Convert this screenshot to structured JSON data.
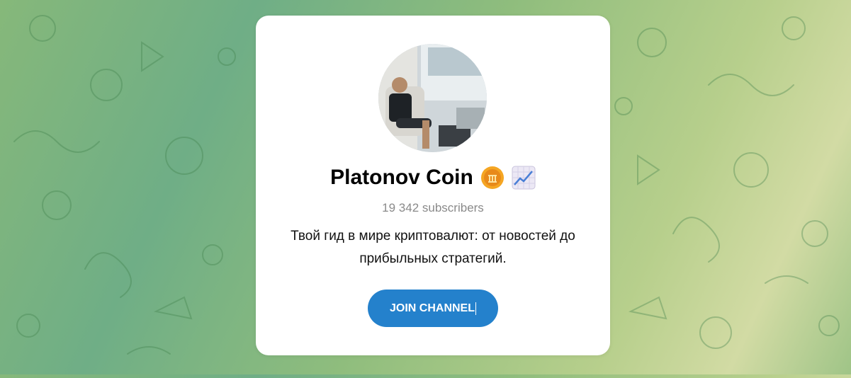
{
  "channel": {
    "title": "Platonov Coin",
    "subscribers": "19 342 subscribers",
    "description": "Твой гид в мире криптовалют: от новостей до прибыльных стратегий.",
    "join_label": "JOIN CHANNEL",
    "title_emojis": [
      "coin-emoji",
      "chart-increasing-emoji"
    ]
  },
  "colors": {
    "button": "#2481cc",
    "subscribers_text": "#8a8a8a",
    "card": "#ffffff"
  }
}
